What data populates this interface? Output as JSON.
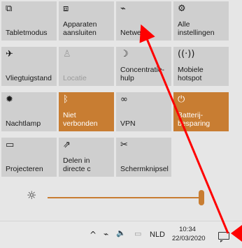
{
  "tiles": [
    {
      "label": "Tabletmodus",
      "icon": "tablet-mode-icon",
      "glyph": "⧉",
      "state": "normal"
    },
    {
      "label": "Apparaten\naansluiten",
      "icon": "connect-devices-icon",
      "glyph": "⧈",
      "state": "normal"
    },
    {
      "label": "Netwerk",
      "icon": "network-icon",
      "glyph": "⌁",
      "state": "normal"
    },
    {
      "label": "Alle\ninstellingen",
      "icon": "gear-icon",
      "glyph": "⚙",
      "state": "normal"
    },
    {
      "label": "Vliegtuigstand",
      "icon": "airplane-icon",
      "glyph": "✈",
      "state": "normal"
    },
    {
      "label": "Locatie",
      "icon": "location-icon",
      "glyph": "♙",
      "state": "dim"
    },
    {
      "label": "Concentratie-\nhulp",
      "icon": "moon-icon",
      "glyph": "☽",
      "state": "normal"
    },
    {
      "label": "Mobiele\nhotspot",
      "icon": "hotspot-icon",
      "glyph": "((·))",
      "state": "normal"
    },
    {
      "label": "Nachtlamp",
      "icon": "sun-icon",
      "glyph": "✹",
      "state": "normal"
    },
    {
      "label": "Niet verbonden",
      "icon": "bluetooth-icon",
      "glyph": "ᛒ",
      "state": "on"
    },
    {
      "label": "VPN",
      "icon": "vpn-icon",
      "glyph": "∞",
      "state": "normal"
    },
    {
      "label": "Batterij-\nbesparing",
      "icon": "battery-saver-icon",
      "glyph": "⏻",
      "state": "on"
    },
    {
      "label": "Projecteren",
      "icon": "project-icon",
      "glyph": "▭",
      "state": "normal"
    },
    {
      "label": "Delen in\ndirecte c",
      "icon": "share-icon",
      "glyph": "⇗",
      "state": "normal"
    },
    {
      "label": "Schermknipsel",
      "icon": "snip-icon",
      "glyph": "✂",
      "state": "normal"
    }
  ],
  "brightness": {
    "icon": "brightness-icon",
    "glyph": "☼",
    "level": 0.98
  },
  "taskbar": {
    "chevron": "^",
    "network_glyph": "⌁",
    "volume_glyph": "🔈",
    "battery_glyph": "▭",
    "language": "NLD",
    "time": "10:34",
    "date": "22/03/2020"
  },
  "colors": {
    "accent": "#c87d32",
    "tile": "#cfcfcf",
    "annotation": "#ff0000"
  }
}
